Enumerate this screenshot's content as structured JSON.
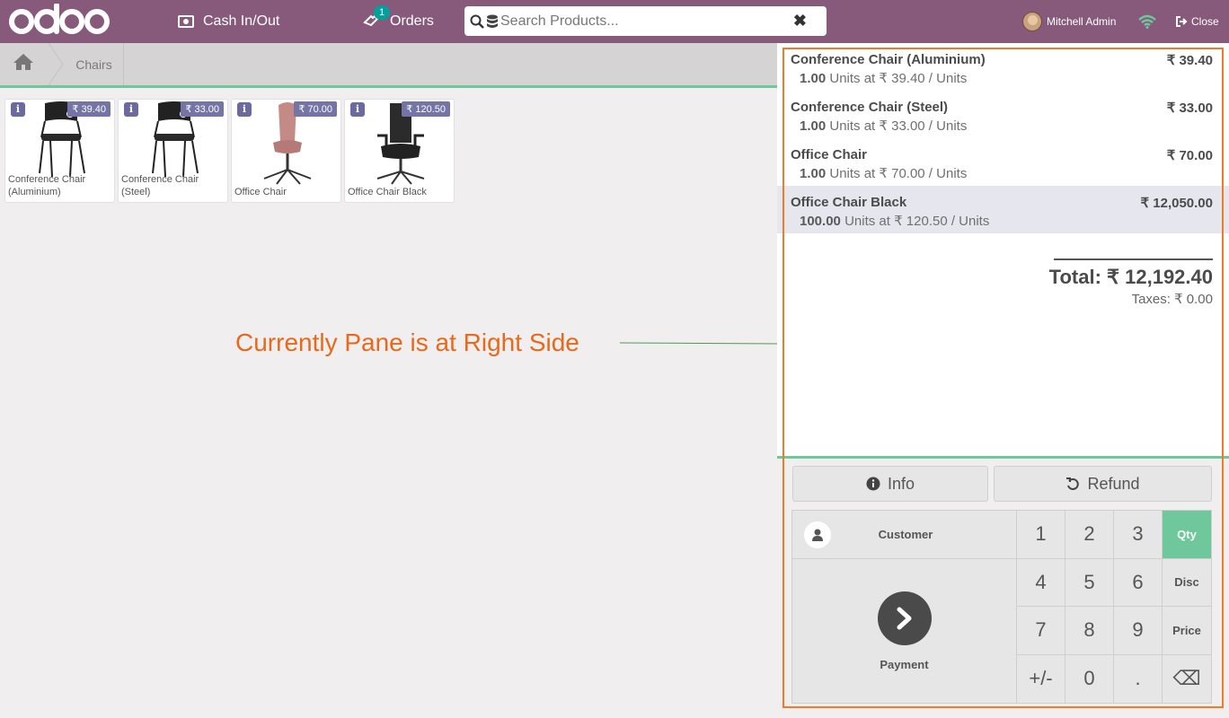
{
  "colors": {
    "brand": "#875a7b",
    "accent": "#6ec89b",
    "annotation": "#e8681c"
  },
  "topbar": {
    "logo_text": "odoo",
    "cash_label": "Cash In/Out",
    "orders_label": "Orders",
    "orders_count": "1",
    "search_placeholder": "Search Products...",
    "user_name": "Mitchell Admin",
    "close_label": "Close"
  },
  "breadcrumb": {
    "category": "Chairs"
  },
  "products": [
    {
      "name": "Conference Chair (Aluminium)",
      "price": "₹ 39.40",
      "image": "conference-chair-black"
    },
    {
      "name": "Conference Chair (Steel)",
      "price": "₹ 33.00",
      "image": "conference-chair-black"
    },
    {
      "name": "Office Chair",
      "price": "₹ 70.00",
      "image": "office-chair-pink"
    },
    {
      "name": "Office Chair Black",
      "price": "₹ 120.50",
      "image": "office-chair-black"
    }
  ],
  "annotation": "Currently Pane is at Right Side",
  "order": {
    "lines": [
      {
        "name": "Conference Chair (Aluminium)",
        "price": "₹ 39.40",
        "qty": "1.00",
        "detail": "Units at ₹ 39.40 / Units"
      },
      {
        "name": "Conference Chair (Steel)",
        "price": "₹ 33.00",
        "qty": "1.00",
        "detail": "Units at ₹ 33.00 / Units"
      },
      {
        "name": "Office Chair",
        "price": "₹ 70.00",
        "qty": "1.00",
        "detail": "Units at ₹ 70.00 / Units"
      },
      {
        "name": "Office Chair Black",
        "price": "₹ 12,050.00",
        "qty": "100.00",
        "detail": "Units at ₹ 120.50 / Units"
      }
    ],
    "total": "Total: ₹ 12,192.40",
    "taxes": "Taxes: ₹ 0.00"
  },
  "controls": {
    "info_label": "Info",
    "refund_label": "Refund",
    "customer_label": "Customer",
    "payment_label": "Payment",
    "keys": [
      "1",
      "2",
      "3",
      "Qty",
      "4",
      "5",
      "6",
      "Disc",
      "7",
      "8",
      "9",
      "Price",
      "+/-",
      "0",
      ".",
      "⌫"
    ],
    "active_mode": "Qty"
  }
}
